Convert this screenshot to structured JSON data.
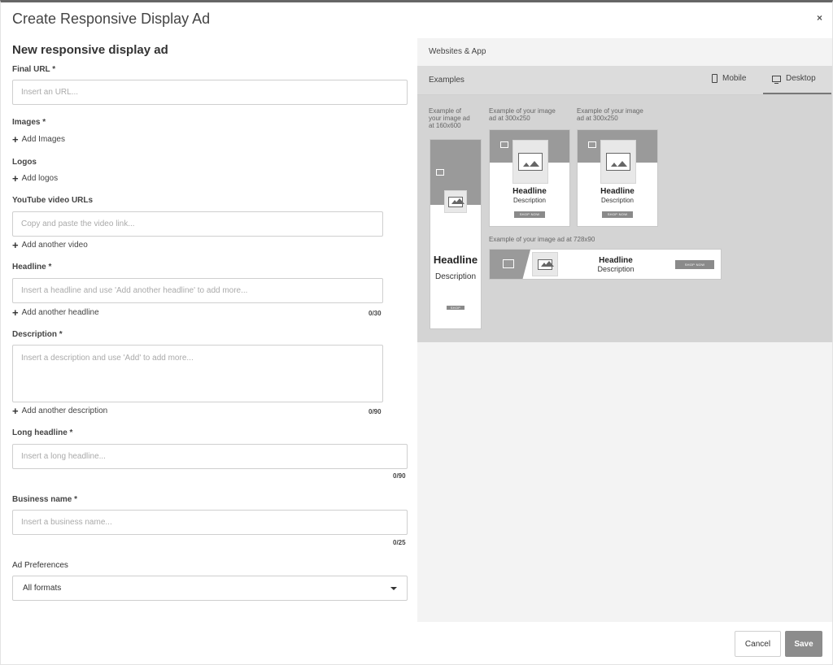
{
  "modal": {
    "title": "Create Responsive Display Ad",
    "close_glyph": "×"
  },
  "form": {
    "heading": "New responsive display ad",
    "final_url": {
      "label": "Final URL *",
      "placeholder": "Insert an URL..."
    },
    "images": {
      "label": "Images *",
      "add_label": "Add Images"
    },
    "logos": {
      "label": "Logos",
      "add_label": "Add logos"
    },
    "youtube": {
      "label": "YouTube video URLs",
      "placeholder": "Copy and paste the video link...",
      "add_label": "Add another video"
    },
    "headline": {
      "label": "Headline *",
      "placeholder": "Insert a headline and use 'Add another headline' to add more...",
      "add_label": "Add another headline",
      "counter": "0/30"
    },
    "description": {
      "label": "Description *",
      "placeholder": "Insert a description and use 'Add' to add more...",
      "add_label": "Add another description",
      "counter": "0/90"
    },
    "long_headline": {
      "label": "Long headline *",
      "placeholder": "Insert a long headline...",
      "counter": "0/90"
    },
    "business_name": {
      "label": "Business name *",
      "placeholder": "Insert a business name...",
      "counter": "0/25"
    },
    "ad_preferences": {
      "label": "Ad Preferences",
      "selected": "All formats"
    },
    "plus_glyph": "+"
  },
  "preview": {
    "top_label": "Websites & App",
    "examples_label": "Examples",
    "tabs": {
      "mobile": "Mobile",
      "desktop": "Desktop",
      "active": "desktop"
    },
    "captions": {
      "c160_line1": "Example of",
      "c160_line2": "your image ad",
      "c160_line3": "at 160x600",
      "c300a_line1": "Example of your image",
      "c300a_line2": "ad at 300x250",
      "c300b_line1": "Example of your image",
      "c300b_line2": "ad at 300x250",
      "c728": "Example of your image ad at 728x90"
    },
    "ad": {
      "headline": "Headline",
      "description": "Description",
      "cta": "SHOP NOW"
    }
  },
  "footer": {
    "cancel": "Cancel",
    "save": "Save"
  },
  "colors": {
    "accent_gray": "#8c8c8c",
    "preview_bg": "#d4d4d4"
  }
}
